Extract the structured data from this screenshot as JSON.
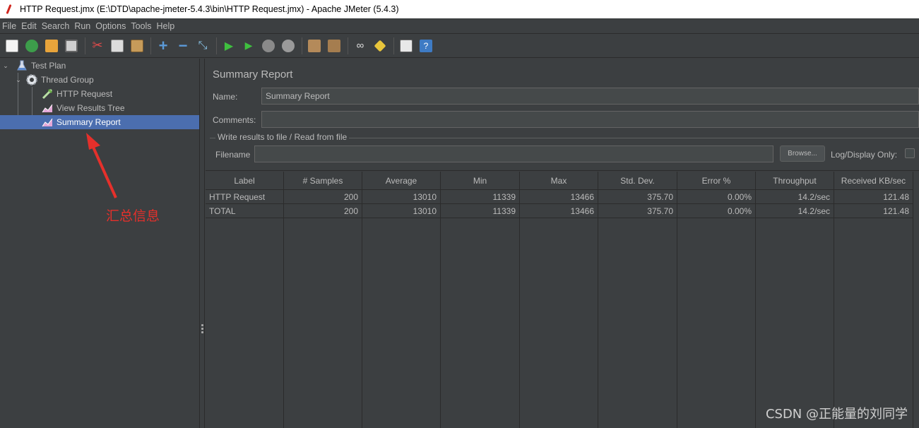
{
  "window": {
    "title": "HTTP Request.jmx (E:\\DTD\\apache-jmeter-5.4.3\\bin\\HTTP Request.jmx) - Apache JMeter (5.4.3)"
  },
  "menu": [
    {
      "label": "File"
    },
    {
      "label": "Edit"
    },
    {
      "label": "Search"
    },
    {
      "label": "Run"
    },
    {
      "label": "Options"
    },
    {
      "label": "Tools"
    },
    {
      "label": "Help"
    }
  ],
  "toolbar": {
    "icons": [
      "new-icon",
      "templates-icon",
      "open-icon",
      "save-icon",
      "cut-icon",
      "copy-icon",
      "paste-icon",
      "expand-icon",
      "collapse-icon",
      "toggle-icon",
      "start-icon",
      "start-no-timers-icon",
      "stop-icon",
      "shutdown-icon",
      "clear-icon",
      "clear-all-icon",
      "search-icon",
      "reset-search-icon",
      "function-helper-icon",
      "help-icon"
    ]
  },
  "tree": {
    "items": [
      {
        "label": "Test Plan",
        "icon": "flask-icon"
      },
      {
        "label": "Thread Group",
        "icon": "gear-icon"
      },
      {
        "label": "HTTP Request",
        "icon": "pipette-icon"
      },
      {
        "label": "View Results Tree",
        "icon": "graph-icon"
      },
      {
        "label": "Summary Report",
        "icon": "graph-icon"
      }
    ],
    "annotation": "汇总信息"
  },
  "panel": {
    "title": "Summary Report",
    "name_label": "Name:",
    "name_value": "Summary Report",
    "comments_label": "Comments:",
    "comments_value": "",
    "file_group_label": "Write results to file / Read from file",
    "filename_label": "Filename",
    "filename_value": "",
    "browse_label": "Browse...",
    "log_display_label": "Log/Display Only:"
  },
  "table": {
    "columns": [
      "Label",
      "# Samples",
      "Average",
      "Min",
      "Max",
      "Std. Dev.",
      "Error %",
      "Throughput",
      "Received KB/sec"
    ],
    "rows": [
      [
        "HTTP Request",
        "200",
        "13010",
        "11339",
        "13466",
        "375.70",
        "0.00%",
        "14.2/sec",
        "121.48"
      ],
      [
        "TOTAL",
        "200",
        "13010",
        "11339",
        "13466",
        "375.70",
        "0.00%",
        "14.2/sec",
        "121.48"
      ]
    ]
  },
  "watermark": "CSDN @正能量的刘同学",
  "colors": {
    "accent": "#4b6eaf",
    "annotation": "#e5302b",
    "background": "#3c3f41"
  }
}
